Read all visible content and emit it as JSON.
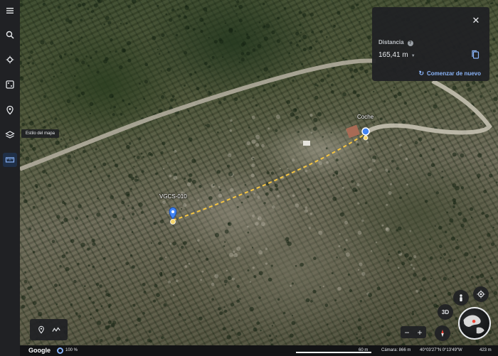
{
  "rail": {
    "tooltip": "Estilo del mapa",
    "items": [
      {
        "name": "menu-icon"
      },
      {
        "name": "search-icon"
      },
      {
        "name": "voyager-icon"
      },
      {
        "name": "feeling-lucky-icon"
      },
      {
        "name": "projects-icon"
      },
      {
        "name": "map-style-icon"
      },
      {
        "name": "measure-icon",
        "active": true
      }
    ]
  },
  "measure": {
    "close": "✕",
    "label": "Distancia",
    "help": "?",
    "value": "165,41 m",
    "caret": "▼",
    "restart": "Comenzar de nuevo",
    "restart_icon": "↻"
  },
  "map": {
    "start_label": "VGCS-010",
    "end_label": "Coche",
    "marker_color": "#4285f4",
    "path_color": "#f5c542"
  },
  "tools": {
    "placemark_icon": "placemark-icon",
    "path_icon": "path-icon"
  },
  "controls": {
    "three_d": "3D",
    "zoom_out": "−",
    "zoom_in": "+",
    "compass_icon": "compass-icon",
    "pegman_icon": "pegman-icon",
    "my_location_icon": "my-location-icon"
  },
  "status": {
    "logo": "Google",
    "zoom": "100 %",
    "scale": "60 m",
    "camera": "Cámara: 866 m",
    "coords": "40°03'27\"N 0°13'49\"W",
    "elevation": "423 m"
  }
}
